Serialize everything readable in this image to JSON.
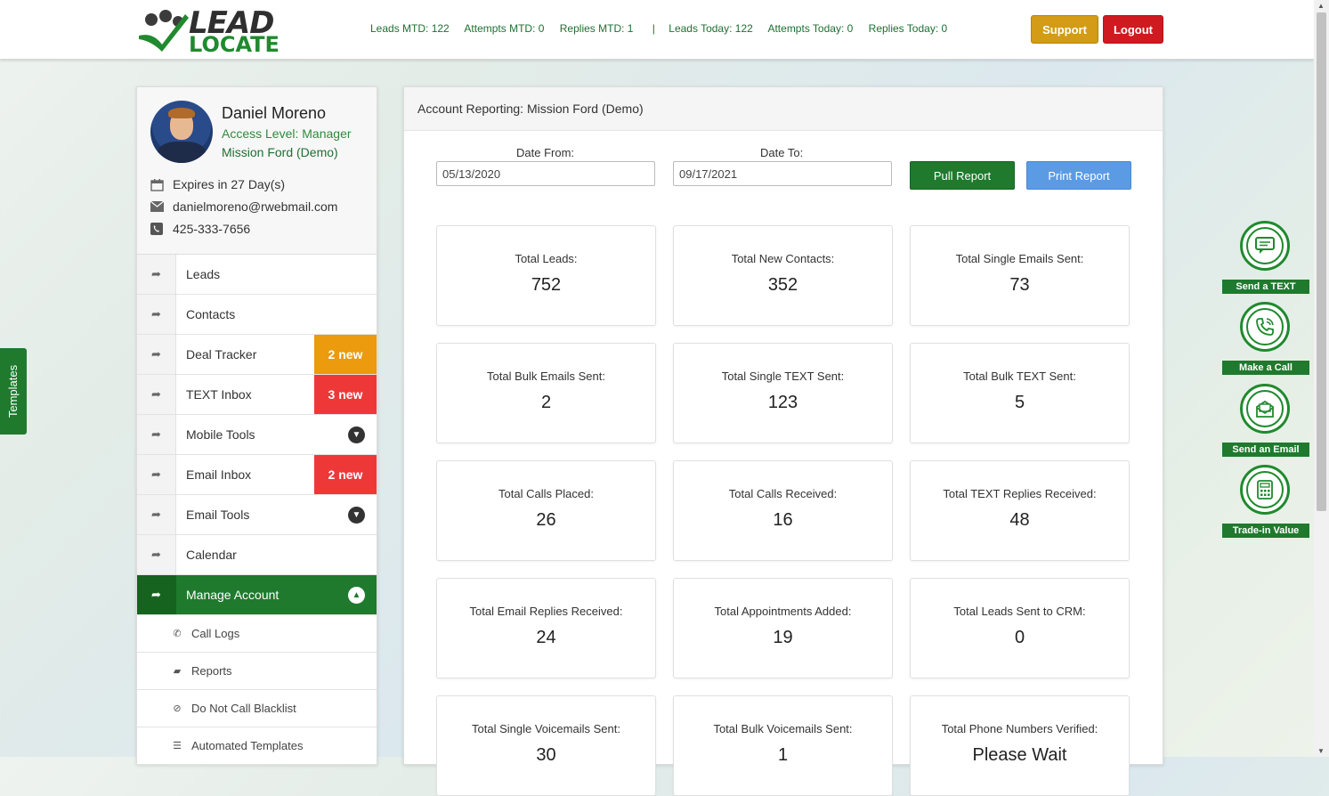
{
  "brand": {
    "line1": "LEAD",
    "line2": "LOCATE"
  },
  "stats": {
    "leads_mtd": "Leads MTD: 122",
    "attempts_mtd": "Attempts MTD: 0",
    "replies_mtd": "Replies MTD: 1",
    "separator": "|",
    "leads_today": "Leads Today: 122",
    "attempts_today": "Attempts Today: 0",
    "replies_today": "Replies Today: 0"
  },
  "header": {
    "support_label": "Support",
    "logout_label": "Logout"
  },
  "profile": {
    "name": "Daniel Moreno",
    "access_level": "Access Level: Manager",
    "dealer": "Mission Ford (Demo)",
    "expires": "Expires in 27 Day(s)",
    "email": "danielmoreno@rwebmail.com",
    "phone": "425-333-7656"
  },
  "sidebar": {
    "items": [
      {
        "label": "Leads"
      },
      {
        "label": "Contacts"
      },
      {
        "label": "Deal Tracker",
        "badge": "2 new"
      },
      {
        "label": "TEXT Inbox",
        "badge": "3 new"
      },
      {
        "label": "Mobile Tools"
      },
      {
        "label": "Email Inbox",
        "badge": "2 new"
      },
      {
        "label": "Email Tools"
      },
      {
        "label": "Calendar"
      },
      {
        "label": "Manage Account"
      }
    ],
    "subitems": [
      {
        "label": "Call Logs"
      },
      {
        "label": "Reports"
      },
      {
        "label": "Do Not Call Blacklist"
      },
      {
        "label": "Automated Templates"
      }
    ]
  },
  "report": {
    "title": "Account Reporting: Mission Ford (Demo)",
    "date_from_label": "Date From:",
    "date_from_value": "05/13/2020",
    "date_to_label": "Date To:",
    "date_to_value": "09/17/2021",
    "pull_label": "Pull Report",
    "print_label": "Print Report",
    "cards": [
      {
        "label": "Total Leads:",
        "value": "752"
      },
      {
        "label": "Total New Contacts:",
        "value": "352"
      },
      {
        "label": "Total Single Emails Sent:",
        "value": "73"
      },
      {
        "label": "Total Bulk Emails Sent:",
        "value": "2"
      },
      {
        "label": "Total Single TEXT Sent:",
        "value": "123"
      },
      {
        "label": "Total Bulk TEXT Sent:",
        "value": "5"
      },
      {
        "label": "Total Calls Placed:",
        "value": "26"
      },
      {
        "label": "Total Calls Received:",
        "value": "16"
      },
      {
        "label": "Total TEXT Replies Received:",
        "value": "48"
      },
      {
        "label": "Total Email Replies Received:",
        "value": "24"
      },
      {
        "label": "Total Appointments Added:",
        "value": "19"
      },
      {
        "label": "Total Leads Sent to CRM:",
        "value": "0"
      },
      {
        "label": "Total Single Voicemails Sent:",
        "value": "30"
      },
      {
        "label": "Total Bulk Voicemails Sent:",
        "value": "1"
      },
      {
        "label": "Total Phone Numbers Verified:",
        "value": "Please Wait"
      }
    ]
  },
  "templates_tab": "Templates",
  "widgets": [
    {
      "label": "Send a TEXT",
      "icon": "text-message-icon"
    },
    {
      "label": "Make a Call",
      "icon": "phone-call-icon"
    },
    {
      "label": "Send an Email",
      "icon": "email-icon"
    },
    {
      "label": "Trade-in Value",
      "icon": "calculator-icon"
    }
  ],
  "colors": {
    "brand_green": "#1f7a2e",
    "support": "#d39b16",
    "logout": "#cf1a1f",
    "badge_orange": "#ec9a0e",
    "badge_red": "#ee3838",
    "print_blue": "#5b9be4"
  }
}
